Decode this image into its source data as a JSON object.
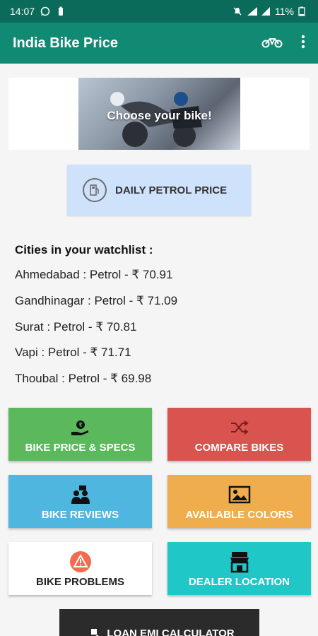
{
  "status": {
    "time": "14:07",
    "battery": "11%"
  },
  "appbar": {
    "title": "India Bike Price"
  },
  "banner": {
    "text": "Choose your bike!"
  },
  "petrol": {
    "label": "DAILY PETROL PRICE"
  },
  "watchlist": {
    "title": "Cities in your watchlist :",
    "cities": [
      "Ahmedabad : Petrol - ₹ 70.91",
      "Gandhinagar : Petrol - ₹ 71.09",
      "Surat : Petrol - ₹ 70.81",
      "Vapi : Petrol - ₹ 71.71",
      "Thoubal : Petrol - ₹ 69.98"
    ]
  },
  "tiles": [
    {
      "label": "BIKE PRICE & SPECS",
      "color": "#5cb85c",
      "icon": "price-tag-hand-icon"
    },
    {
      "label": "COMPARE BIKES",
      "color": "#d9534f",
      "icon": "shuffle-icon"
    },
    {
      "label": "BIKE REVIEWS",
      "color": "#4fb6e0",
      "icon": "people-chat-icon"
    },
    {
      "label": "AVAILABLE COLORS",
      "color": "#f0ad4e",
      "icon": "image-icon"
    },
    {
      "label": "BIKE PROBLEMS",
      "color": "#ffffff",
      "icon": "warning-icon"
    },
    {
      "label": "DEALER LOCATION",
      "color": "#1fc7c7",
      "icon": "shop-icon"
    }
  ],
  "emi": {
    "label": "LOAN EMI CALCULATOR"
  },
  "colors": {
    "status_bar": "#0b6b5a",
    "app_bar": "#108a73",
    "petrol_button": "#cfe2fb"
  }
}
